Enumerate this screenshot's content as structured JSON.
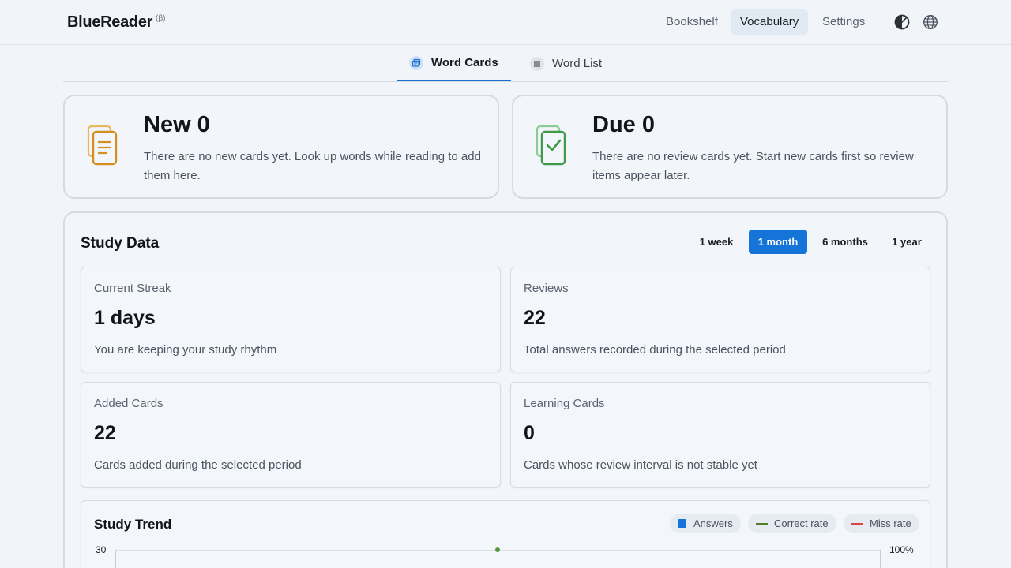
{
  "app": {
    "name": "BlueReader",
    "badge": "(β)"
  },
  "nav": {
    "items": [
      {
        "label": "Bookshelf",
        "active": false
      },
      {
        "label": "Vocabulary",
        "active": true
      },
      {
        "label": "Settings",
        "active": false
      }
    ],
    "icons": [
      "theme-toggle-icon",
      "language-globe-icon"
    ]
  },
  "tabs": [
    {
      "label": "Word Cards",
      "icon": "cards-icon",
      "active": true
    },
    {
      "label": "Word List",
      "icon": "list-icon",
      "active": false
    }
  ],
  "summary": {
    "new": {
      "title": "New 0",
      "description": "There are no new cards yet. Look up words while reading to add them here.",
      "icon": "new-cards-icon",
      "color": "#d4901f"
    },
    "due": {
      "title": "Due 0",
      "description": "There are no review cards yet. Start new cards first so review items appear later.",
      "icon": "due-cards-check-icon",
      "color": "#3f9a4a"
    }
  },
  "study_data": {
    "title": "Study Data",
    "periods": [
      {
        "label": "1 week",
        "active": false
      },
      {
        "label": "1 month",
        "active": true
      },
      {
        "label": "6 months",
        "active": false
      },
      {
        "label": "1 year",
        "active": false
      }
    ],
    "stats": [
      {
        "label": "Current Streak",
        "value": "1 days",
        "note": "You are keeping your study rhythm"
      },
      {
        "label": "Reviews",
        "value": "22",
        "note": "Total answers recorded during the selected period"
      },
      {
        "label": "Added Cards",
        "value": "22",
        "note": "Cards added during the selected period"
      },
      {
        "label": "Learning Cards",
        "value": "0",
        "note": "Cards whose review interval is not stable yet"
      }
    ]
  },
  "study_trend": {
    "title": "Study Trend",
    "legend": [
      {
        "label": "Answers",
        "color": "#1474d8",
        "kind": "square"
      },
      {
        "label": "Correct rate",
        "color": "#4f7d2e",
        "kind": "line"
      },
      {
        "label": "Miss rate",
        "color": "#d64545",
        "kind": "line"
      }
    ],
    "left_axis_top": "30",
    "right_axis_top": "100%"
  },
  "colors": {
    "accent": "#1474d8",
    "background": "#f1f4f8"
  }
}
